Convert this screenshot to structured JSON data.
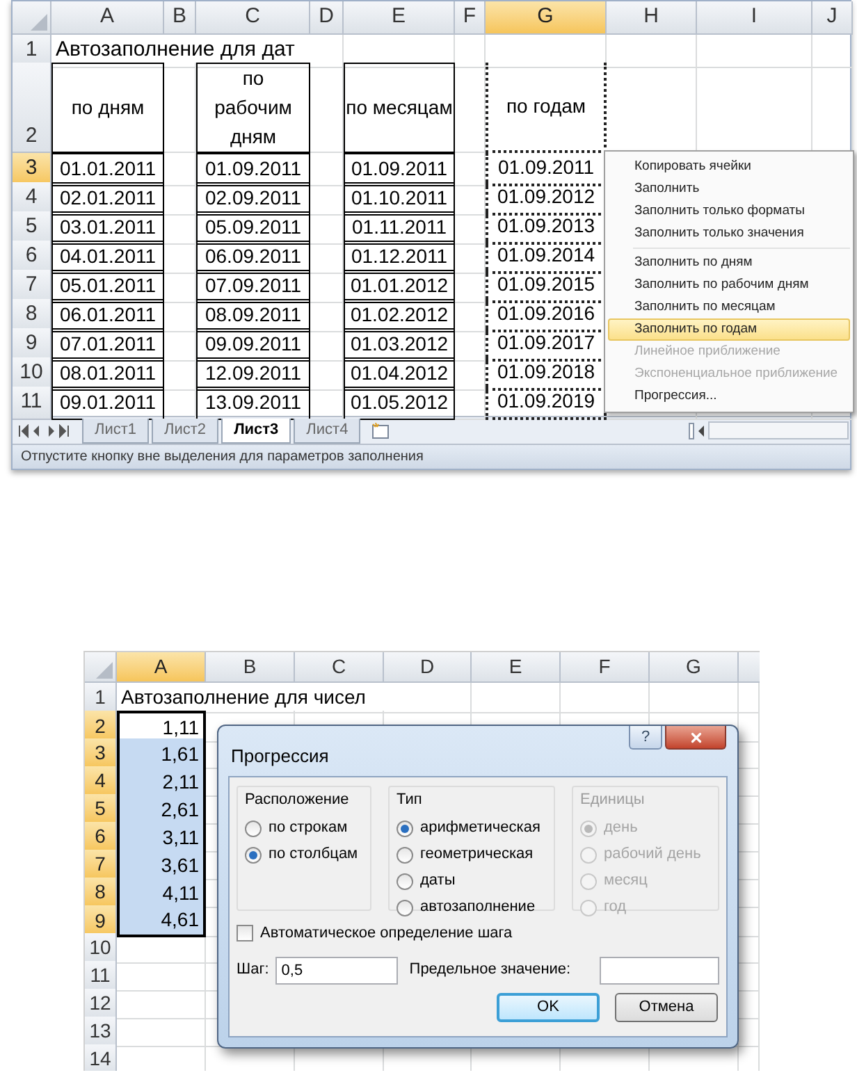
{
  "top_sheet": {
    "columns": [
      {
        "label": "A",
        "selected": false
      },
      {
        "label": "B",
        "selected": false
      },
      {
        "label": "C",
        "selected": false
      },
      {
        "label": "D",
        "selected": false
      },
      {
        "label": "E",
        "selected": false
      },
      {
        "label": "F",
        "selected": false
      },
      {
        "label": "G",
        "selected": true
      },
      {
        "label": "H",
        "selected": false
      },
      {
        "label": "I",
        "selected": false
      },
      {
        "label": "J",
        "selected": false
      }
    ],
    "rows": [
      {
        "label": "1",
        "selected": false
      },
      {
        "label": "2",
        "selected": false
      },
      {
        "label": "3",
        "selected": true
      },
      {
        "label": "4",
        "selected": false
      },
      {
        "label": "5",
        "selected": false
      },
      {
        "label": "6",
        "selected": false
      },
      {
        "label": "7",
        "selected": false
      },
      {
        "label": "8",
        "selected": false
      },
      {
        "label": "9",
        "selected": false
      },
      {
        "label": "10",
        "selected": false
      },
      {
        "label": "11",
        "selected": false
      }
    ],
    "title": "Автозаполнение для дат",
    "table_columns": [
      {
        "header": "по дням",
        "selected": false,
        "cells": [
          "01.01.2011",
          "02.01.2011",
          "03.01.2011",
          "04.01.2011",
          "05.01.2011",
          "06.01.2011",
          "07.01.2011",
          "08.01.2011",
          "09.01.2011"
        ]
      },
      {
        "header": "по рабочим дням",
        "selected": false,
        "cells": [
          "01.09.2011",
          "02.09.2011",
          "05.09.2011",
          "06.09.2011",
          "07.09.2011",
          "08.09.2011",
          "09.09.2011",
          "12.09.2011",
          "13.09.2011"
        ]
      },
      {
        "header": "по месяцам",
        "selected": false,
        "cells": [
          "01.09.2011",
          "01.10.2011",
          "01.11.2011",
          "01.12.2011",
          "01.01.2012",
          "01.02.2012",
          "01.03.2012",
          "01.04.2012",
          "01.05.2012"
        ]
      },
      {
        "header": "по годам",
        "selected": true,
        "cells": [
          "01.09.2011",
          "01.09.2012",
          "01.09.2013",
          "01.09.2014",
          "01.09.2015",
          "01.09.2016",
          "01.09.2017",
          "01.09.2018",
          "01.09.2019"
        ]
      }
    ],
    "context_menu": {
      "groups": [
        [
          {
            "label": "Копировать ячейки",
            "disabled": false,
            "selected": false
          },
          {
            "label": "Заполнить",
            "disabled": false,
            "selected": false
          },
          {
            "label": "Заполнить только форматы",
            "disabled": false,
            "selected": false
          },
          {
            "label": "Заполнить только значения",
            "disabled": false,
            "selected": false
          }
        ],
        [
          {
            "label": "Заполнить по дням",
            "disabled": false,
            "selected": false
          },
          {
            "label": "Заполнить по рабочим дням",
            "disabled": false,
            "selected": false
          },
          {
            "label": "Заполнить по месяцам",
            "disabled": false,
            "selected": false
          },
          {
            "label": "Заполнить по годам",
            "disabled": false,
            "selected": true
          },
          {
            "label": "Линейное приближение",
            "disabled": true,
            "selected": false
          },
          {
            "label": "Экспоненциальное приближение",
            "disabled": true,
            "selected": false
          },
          {
            "label": "Прогрессия...",
            "disabled": false,
            "selected": false
          }
        ]
      ]
    },
    "sheet_tabs": [
      {
        "label": "Лист1",
        "selected": false
      },
      {
        "label": "Лист2",
        "selected": false
      },
      {
        "label": "Лист3",
        "selected": true
      },
      {
        "label": "Лист4",
        "selected": false
      }
    ],
    "status_bar": "Отпустите кнопку вне выделения для параметров заполнения"
  },
  "bottom_sheet": {
    "columns": [
      {
        "label": "A",
        "selected": true
      },
      {
        "label": "B",
        "selected": false
      },
      {
        "label": "C",
        "selected": false
      },
      {
        "label": "D",
        "selected": false
      },
      {
        "label": "E",
        "selected": false
      },
      {
        "label": "F",
        "selected": false
      },
      {
        "label": "G",
        "selected": false
      }
    ],
    "title": "Автозаполнение для чисел",
    "rows": [
      {
        "label": "1",
        "selected": false
      },
      {
        "label": "2",
        "selected": true,
        "cell": {
          "value": "1,11",
          "active": true
        }
      },
      {
        "label": "3",
        "selected": true,
        "cell": {
          "value": "1,61",
          "active": false
        }
      },
      {
        "label": "4",
        "selected": true,
        "cell": {
          "value": "2,11",
          "active": false
        }
      },
      {
        "label": "5",
        "selected": true,
        "cell": {
          "value": "2,61",
          "active": false
        }
      },
      {
        "label": "6",
        "selected": true,
        "cell": {
          "value": "3,11",
          "active": false
        }
      },
      {
        "label": "7",
        "selected": true,
        "cell": {
          "value": "3,61",
          "active": false
        }
      },
      {
        "label": "8",
        "selected": true,
        "cell": {
          "value": "4,11",
          "active": false
        }
      },
      {
        "label": "9",
        "selected": true,
        "cell": {
          "value": "4,61",
          "active": false
        }
      },
      {
        "label": "10",
        "selected": false
      },
      {
        "label": "11",
        "selected": false
      },
      {
        "label": "12",
        "selected": false
      },
      {
        "label": "13",
        "selected": false
      },
      {
        "label": "14",
        "selected": false
      }
    ],
    "dialog": {
      "title": "Прогрессия",
      "help_button": "?",
      "groups": [
        {
          "label": "Расположение",
          "disabled": false,
          "options": [
            {
              "label": "по строкам",
              "selected": false
            },
            {
              "label": "по столбцам",
              "selected": true
            }
          ]
        },
        {
          "label": "Тип",
          "disabled": false,
          "options": [
            {
              "label": "арифметическая",
              "selected": true
            },
            {
              "label": "геометрическая",
              "selected": false
            },
            {
              "label": "даты",
              "selected": false
            },
            {
              "label": "автозаполнение",
              "selected": false
            }
          ]
        },
        {
          "label": "Единицы",
          "disabled": true,
          "options": [
            {
              "label": "день",
              "selected": true
            },
            {
              "label": "рабочий день",
              "selected": false
            },
            {
              "label": "месяц",
              "selected": false
            },
            {
              "label": "год",
              "selected": false
            }
          ]
        }
      ],
      "auto_step": {
        "label": "Автоматическое определение шага",
        "checked": false
      },
      "step": {
        "label": "Шаг:",
        "value": "0,5"
      },
      "limit": {
        "label": "Предельное значение:"
      },
      "buttons": [
        {
          "label": "OK",
          "default": true
        },
        {
          "label": "Отмена",
          "default": false
        }
      ]
    }
  }
}
